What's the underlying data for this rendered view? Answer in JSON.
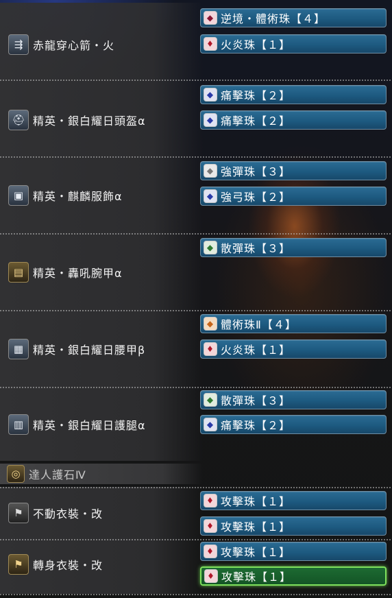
{
  "equipment": [
    {
      "name": "赤龍穿心箭・火",
      "icon": "bow-icon",
      "icon_glyph": "⇶",
      "decorations": [
        {
          "label": "逆境・體術珠【４】",
          "gem": "maroon",
          "gem_glyph": "◆"
        },
        {
          "label": "火炎珠【１】",
          "gem": "red",
          "gem_glyph": "♦"
        }
      ]
    },
    {
      "name": "精英・銀白耀日頭盔α",
      "icon": "helmet-icon",
      "icon_glyph": "⛑",
      "decorations": [
        {
          "label": "痛擊珠【２】",
          "gem": "blue",
          "gem_glyph": "◆"
        },
        {
          "label": "痛擊珠【２】",
          "gem": "blue",
          "gem_glyph": "◆"
        }
      ]
    },
    {
      "name": "精英・麒麟服飾α",
      "icon": "chest-icon",
      "icon_glyph": "▣",
      "decorations": [
        {
          "label": "強彈珠【３】",
          "gem": "gray",
          "gem_glyph": "◆"
        },
        {
          "label": "強弓珠【２】",
          "gem": "blue",
          "gem_glyph": "◆"
        }
      ]
    },
    {
      "name": "精英・轟吼腕甲α",
      "icon": "arms-icon",
      "icon_glyph": "▤",
      "icon_style": "gold",
      "decorations": [
        {
          "label": "散彈珠【３】",
          "gem": "green",
          "gem_glyph": "◆"
        }
      ]
    },
    {
      "name": "精英・銀白耀日腰甲β",
      "icon": "waist-icon",
      "icon_glyph": "▦",
      "decorations": [
        {
          "label": "體術珠Ⅱ【４】",
          "gem": "orange",
          "gem_glyph": "◆"
        },
        {
          "label": "火炎珠【１】",
          "gem": "red",
          "gem_glyph": "♦"
        }
      ]
    },
    {
      "name": "精英・銀白耀日護腿α",
      "icon": "legs-icon",
      "icon_glyph": "▥",
      "decorations": [
        {
          "label": "散彈珠【３】",
          "gem": "green",
          "gem_glyph": "◆"
        },
        {
          "label": "痛擊珠【２】",
          "gem": "blue",
          "gem_glyph": "◆"
        }
      ]
    }
  ],
  "talisman": {
    "name": "達人護石Ⅳ",
    "icon": "charm-icon",
    "icon_glyph": "◎"
  },
  "mantles": [
    {
      "name": "不動衣裝・改",
      "icon": "mantle-icon",
      "icon_glyph": "⚑",
      "decorations": [
        {
          "label": "攻擊珠【１】",
          "gem": "red",
          "gem_glyph": "♦"
        },
        {
          "label": "攻擊珠【１】",
          "gem": "red",
          "gem_glyph": "♦"
        }
      ]
    },
    {
      "name": "轉身衣裝・改",
      "icon": "mantle-icon",
      "icon_glyph": "⚑",
      "icon_style": "gold",
      "decorations": [
        {
          "label": "攻擊珠【１】",
          "gem": "red",
          "gem_glyph": "♦"
        },
        {
          "label": "攻擊珠【１】",
          "gem": "red",
          "gem_glyph": "♦",
          "selected": true
        }
      ]
    }
  ]
}
